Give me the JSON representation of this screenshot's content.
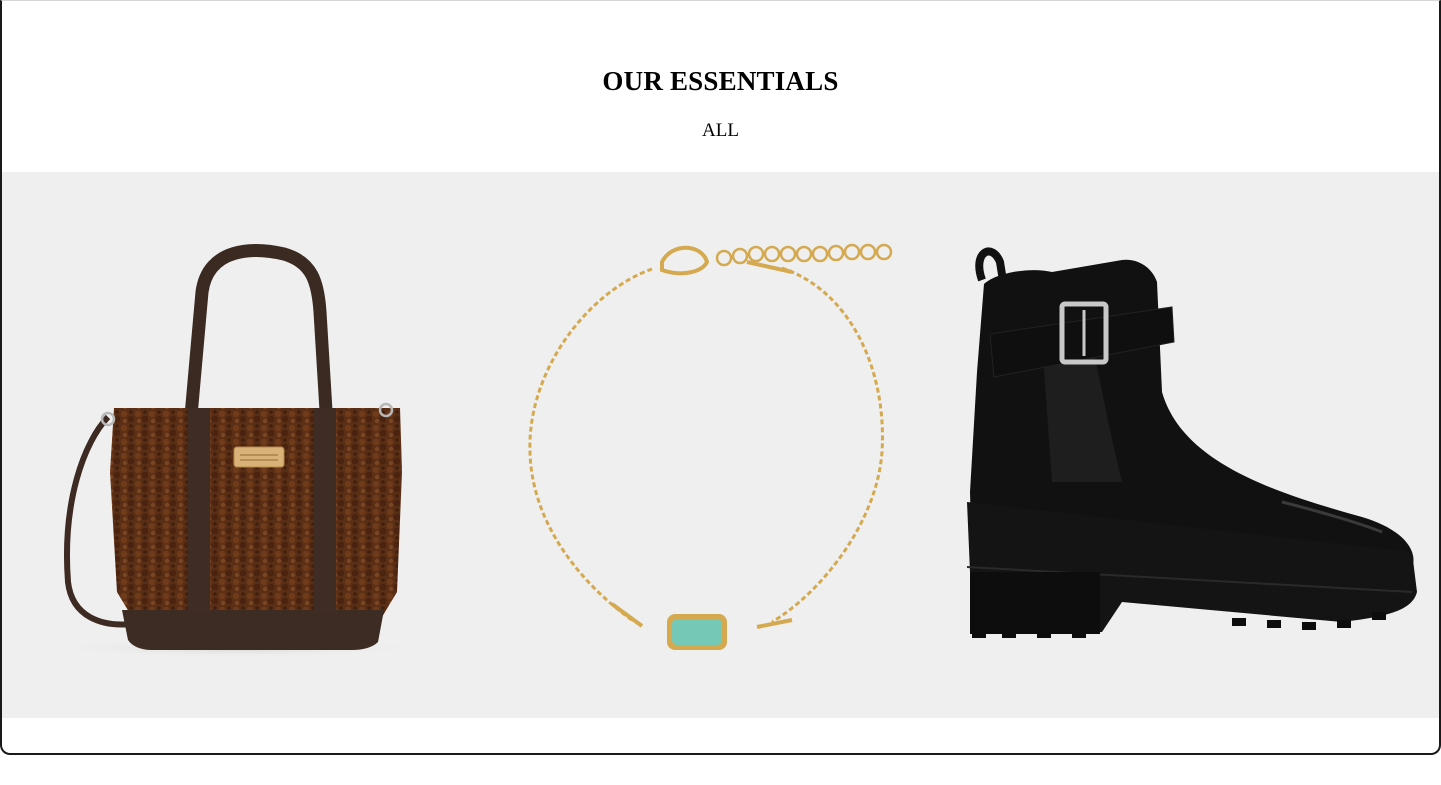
{
  "section": {
    "title": "OUR ESSENTIALS",
    "filter_label": "ALL"
  },
  "products": [
    {
      "icon": "tote-bag-image",
      "color": "#5a2f14"
    },
    {
      "icon": "bracelet-image",
      "color": "#d4a94f"
    },
    {
      "icon": "ankle-boot-image",
      "color": "#0e0e0e"
    }
  ],
  "colors": {
    "gallery_background": "#efefef",
    "page_background": "#ffffff",
    "text": "#000000"
  }
}
